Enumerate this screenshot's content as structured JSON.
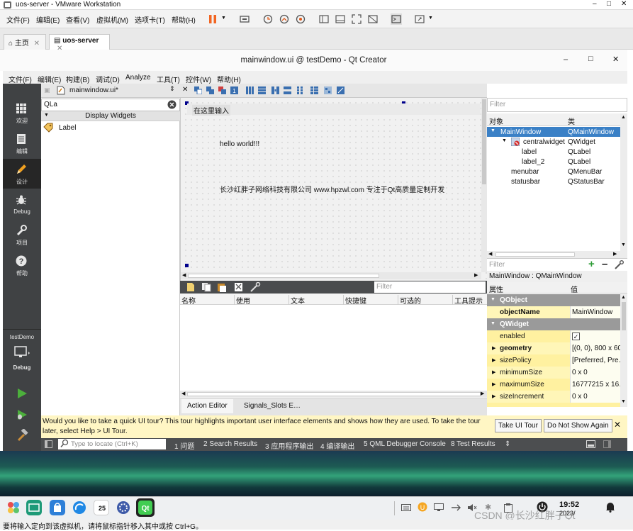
{
  "vmware": {
    "title": "uos-server - VMware Workstation",
    "menu": [
      "文件(F)",
      "编辑(E)",
      "查看(V)",
      "虚拟机(M)",
      "选项卡(T)",
      "帮助(H)"
    ],
    "tabs": [
      "主页",
      "uos-server"
    ],
    "status": "要将输入定向到该虚拟机，请将鼠标指针移入其中或按 Ctrl+G。"
  },
  "qt": {
    "title": "mainwindow.ui @ testDemo - Qt Creator",
    "menu": [
      "文件(F)",
      "编辑(E)",
      "构建(B)",
      "调试(D)",
      "Analyze",
      "工具(T)",
      "控件(W)",
      "帮助(H)"
    ],
    "modes": [
      "欢迎",
      "编辑",
      "设计",
      "Debug",
      "项目",
      "帮助"
    ],
    "active_mode": "设计",
    "project": {
      "name": "testDemo",
      "config": "Debug"
    }
  },
  "editor": {
    "file": "mainwindow.ui*"
  },
  "widget_box": {
    "filter": "QLa",
    "category": "Display Widgets",
    "items": [
      "Label"
    ]
  },
  "form": {
    "menu_placeholder": "在这里输入",
    "labels": [
      "hello world!!!",
      "长沙红胖子网络科技有限公司 www.hpzwl.com 专注于Qt高质量定制开发"
    ]
  },
  "action_editor": {
    "filter_placeholder": "Filter",
    "columns": [
      "名称",
      "使用",
      "文本",
      "快捷键",
      "可选的",
      "工具提示"
    ],
    "tabs": [
      "Action Editor",
      "Signals_Slots E…"
    ]
  },
  "object_inspector": {
    "filter_placeholder": "Filter",
    "columns": [
      "对象",
      "类"
    ],
    "rows": [
      {
        "name": "MainWindow",
        "cls": "QMainWindow",
        "selected": true
      },
      {
        "name": "centralwidget",
        "cls": "QWidget"
      },
      {
        "name": "label",
        "cls": "QLabel"
      },
      {
        "name": "label_2",
        "cls": "QLabel"
      },
      {
        "name": "menubar",
        "cls": "QMenuBar"
      },
      {
        "name": "statusbar",
        "cls": "QStatusBar"
      }
    ]
  },
  "property_editor": {
    "filter_placeholder": "Filter",
    "class_label": "MainWindow : QMainWindow",
    "columns": [
      "属性",
      "值"
    ],
    "rows": [
      {
        "name": "QObject",
        "value": "",
        "group": true
      },
      {
        "name": "objectName",
        "value": "MainWindow"
      },
      {
        "name": "QWidget",
        "value": "",
        "group": true
      },
      {
        "name": "enabled",
        "value": "✓"
      },
      {
        "name": "geometry",
        "value": "[(0, 0), 800 x 600"
      },
      {
        "name": "sizePolicy",
        "value": "[Preferred, Pre…"
      },
      {
        "name": "minimumSize",
        "value": "0 x 0"
      },
      {
        "name": "maximumSize",
        "value": "16777215 x 16…"
      },
      {
        "name": "sizeIncrement",
        "value": "0 x 0"
      }
    ]
  },
  "tour": {
    "text": "Would you like to take a quick UI tour? This tour highlights important user interface elements and shows how they are used. To take the tour later, select Help > UI Tour.",
    "take": "Take UI Tour",
    "dismiss": "Do Not Show Again"
  },
  "output": {
    "locate_placeholder": "Type to locate (Ctrl+K)",
    "panes": [
      "1  问题",
      "2  Search Results",
      "3  应用程序输出",
      "4  编译输出",
      "5  QML Debugger Console",
      "8  Test Results"
    ]
  },
  "taskbar": {
    "time": "19:52",
    "date_partial": "2023/",
    "calendar_day": "25",
    "watermark": "CSDN @长沙红胖子Qt"
  }
}
